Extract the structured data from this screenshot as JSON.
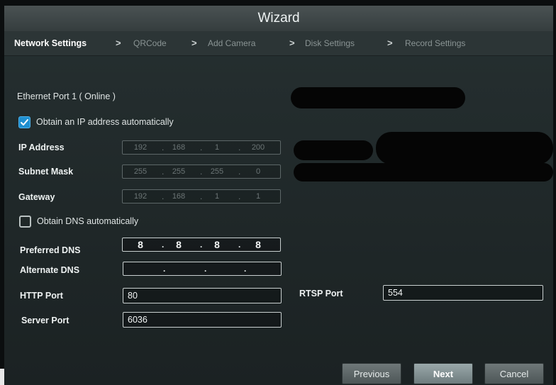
{
  "window": {
    "title": "Wizard"
  },
  "steps": [
    {
      "label": "Network Settings",
      "active": true
    },
    {
      "label": "QRCode",
      "active": false
    },
    {
      "label": "Add Camera",
      "active": false
    },
    {
      "label": "Disk Settings",
      "active": false
    },
    {
      "label": "Record Settings",
      "active": false
    }
  ],
  "step_separator": ">",
  "ethernet": {
    "label": "Ethernet Port 1 ( Online )"
  },
  "obtain_ip": {
    "label": "Obtain an IP address automatically",
    "checked": true
  },
  "ip_address": {
    "label": "IP Address",
    "octets": [
      "192",
      "168",
      "1",
      "200"
    ]
  },
  "subnet_mask": {
    "label": "Subnet Mask",
    "octets": [
      "255",
      "255",
      "255",
      "0"
    ]
  },
  "gateway": {
    "label": "Gateway",
    "octets": [
      "192",
      "168",
      "1",
      "1"
    ]
  },
  "obtain_dns": {
    "label": "Obtain DNS automatically",
    "checked": false
  },
  "preferred_dns": {
    "label": "Preferred DNS",
    "octets": [
      "8",
      "8",
      "8",
      "8"
    ]
  },
  "alternate_dns": {
    "label": "Alternate DNS",
    "octets": [
      "",
      "",
      "",
      ""
    ]
  },
  "http_port": {
    "label": "HTTP Port",
    "value": "80"
  },
  "rtsp_port": {
    "label": "RTSP Port",
    "value": "554"
  },
  "server_port": {
    "label": "Server Port",
    "value": "6036"
  },
  "buttons": {
    "previous": "Previous",
    "next": "Next",
    "cancel": "Cancel"
  },
  "ip_separator": ".",
  "colors": {
    "accent": "#1f8fd0",
    "background": "#232b2c",
    "titlebar": "#3f4748"
  }
}
